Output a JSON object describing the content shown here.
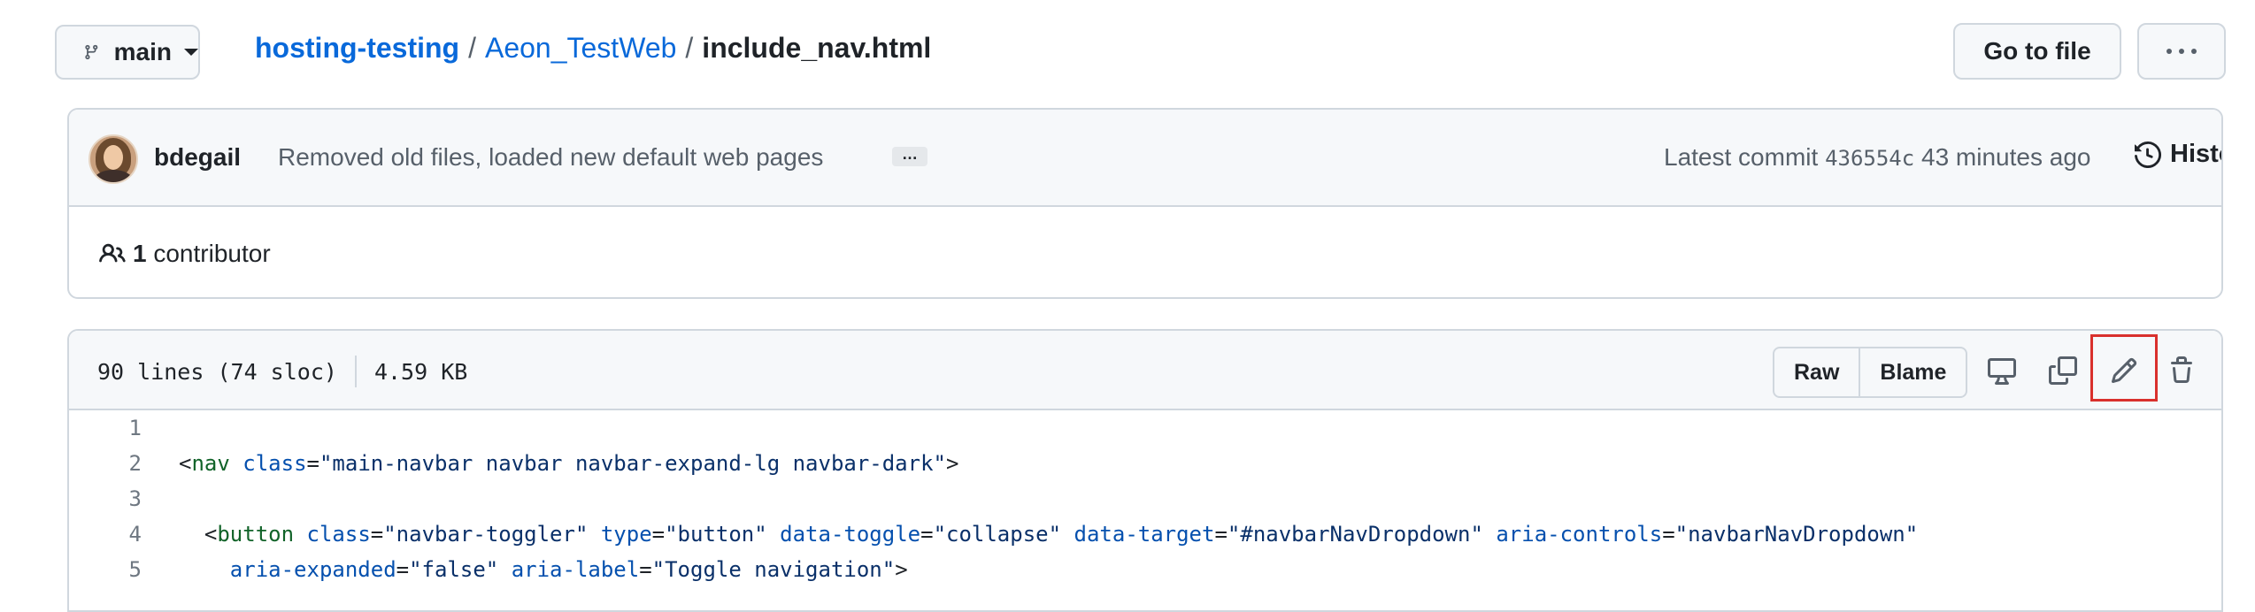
{
  "branch": {
    "label": "main"
  },
  "breadcrumb": {
    "repo": "hosting-testing",
    "sep1": "/",
    "dir": "Aeon_TestWeb",
    "sep2": "/",
    "file": "include_nav.html"
  },
  "actions": {
    "go_to_file": "Go to file"
  },
  "commit": {
    "author": "bdegail",
    "message": "Removed old files, loaded new default web pages",
    "ellipsis": "…",
    "latest_label": "Latest commit",
    "sha": "436554c",
    "time": "43 minutes ago",
    "history_label": "History"
  },
  "contributors": {
    "count": "1",
    "label": "contributor"
  },
  "file": {
    "lines_info": "90 lines (74 sloc)",
    "size": "4.59 KB",
    "raw_label": "Raw",
    "blame_label": "Blame"
  },
  "code": {
    "line_numbers": [
      "1",
      "2",
      "3",
      "4",
      "5"
    ],
    "l2": {
      "open": "<",
      "tag": "nav",
      "sp": " ",
      "a1": "class",
      "eq": "=",
      "v1": "\"main-navbar navbar navbar-expand-lg navbar-dark\"",
      "close": ">"
    },
    "l4": {
      "open": "<",
      "tag": "button",
      "a1": "class",
      "v1": "\"navbar-toggler\"",
      "a2": "type",
      "v2": "\"button\"",
      "a3": "data-toggle",
      "v3": "\"collapse\"",
      "a4": "data-target",
      "v4": "\"#navbarNavDropdown\"",
      "a5": "aria-controls",
      "v5": "\"navbarNavDropdown\""
    },
    "l5": {
      "a1": "aria-expanded",
      "v1": "\"false\"",
      "a2": "aria-label",
      "v2": "\"Toggle navigation\"",
      "close": ">"
    }
  },
  "colors": {
    "link": "#0969da",
    "highlight": "#d9302c",
    "border": "#d0d7de"
  }
}
